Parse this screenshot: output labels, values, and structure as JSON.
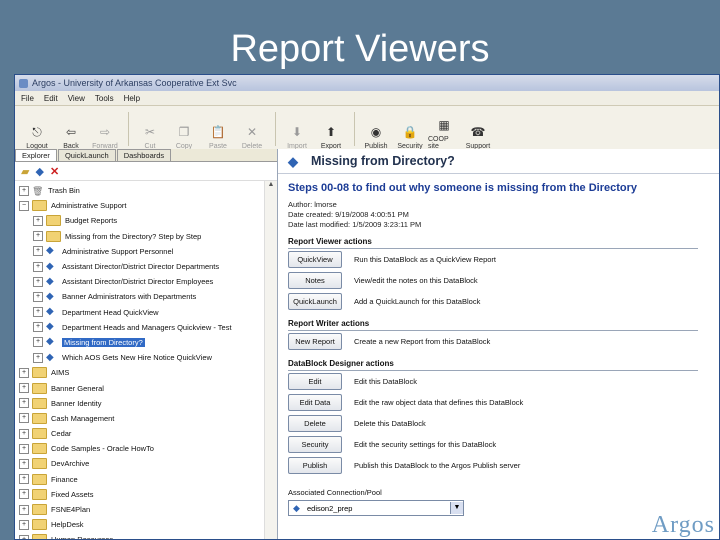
{
  "slide": {
    "title": "Report Viewers"
  },
  "window": {
    "title": "Argos - University of Arkansas Cooperative Ext Svc"
  },
  "menu": [
    "File",
    "Edit",
    "View",
    "Tools",
    "Help"
  ],
  "toolbar": [
    {
      "label": "Logout",
      "icon": "logout-icon",
      "glyph": "⎋",
      "disabled": false
    },
    {
      "label": "Back",
      "icon": "back-arrow-icon",
      "glyph": "⇦",
      "disabled": false
    },
    {
      "label": "Forward",
      "icon": "forward-arrow-icon",
      "glyph": "⇨",
      "disabled": true
    },
    {
      "label": "Cut",
      "icon": "scissors-icon",
      "glyph": "✂",
      "disabled": true
    },
    {
      "label": "Copy",
      "icon": "copy-icon",
      "glyph": "❐",
      "disabled": true
    },
    {
      "label": "Paste",
      "icon": "paste-icon",
      "glyph": "📋",
      "disabled": true
    },
    {
      "label": "Delete",
      "icon": "delete-icon",
      "glyph": "✕",
      "disabled": true
    },
    {
      "label": "Import",
      "icon": "import-icon",
      "glyph": "⬇",
      "disabled": true
    },
    {
      "label": "Export",
      "icon": "export-icon",
      "glyph": "⬆",
      "disabled": false
    },
    {
      "label": "Publish",
      "icon": "publish-globe-icon",
      "glyph": "◉",
      "disabled": false
    },
    {
      "label": "Security",
      "icon": "security-lock-icon",
      "glyph": "🔒",
      "disabled": false
    },
    {
      "label": "COOP site",
      "icon": "coop-site-icon",
      "glyph": "▦",
      "disabled": false
    },
    {
      "label": "Support",
      "icon": "support-icon",
      "glyph": "☎",
      "disabled": false
    }
  ],
  "tabs": [
    "Explorer",
    "QuickLaunch",
    "Dashboards"
  ],
  "tree": [
    {
      "label": "Trash Bin",
      "type": "trash",
      "indent": 0,
      "exp": "+"
    },
    {
      "label": "Administrative Support",
      "type": "folder",
      "indent": 0,
      "exp": "−"
    },
    {
      "label": "Budget Reports",
      "type": "folder",
      "indent": 1,
      "exp": "+"
    },
    {
      "label": "Missing from the Directory? Step by Step",
      "type": "folder",
      "indent": 1,
      "exp": "+"
    },
    {
      "label": "Administrative Support Personnel",
      "type": "db",
      "indent": 1,
      "exp": "+"
    },
    {
      "label": "Assistant Director/District Director Departments",
      "type": "db",
      "indent": 1,
      "exp": "+"
    },
    {
      "label": "Assistant Director/District Director Employees",
      "type": "db",
      "indent": 1,
      "exp": "+"
    },
    {
      "label": "Banner Administrators with Departments",
      "type": "db",
      "indent": 1,
      "exp": "+"
    },
    {
      "label": "Department Head QuickView",
      "type": "db",
      "indent": 1,
      "exp": "+"
    },
    {
      "label": "Department Heads and Managers Quickview - Test",
      "type": "db",
      "indent": 1,
      "exp": "+"
    },
    {
      "label": "Missing from Directory?",
      "type": "db",
      "indent": 1,
      "exp": "+",
      "selected": true
    },
    {
      "label": "Which AOS Gets New Hire Notice QuickView",
      "type": "db",
      "indent": 1,
      "exp": "+"
    },
    {
      "label": "AIMS",
      "type": "folder",
      "indent": 0,
      "exp": "+"
    },
    {
      "label": "Banner General",
      "type": "folder",
      "indent": 0,
      "exp": "+"
    },
    {
      "label": "Banner Identity",
      "type": "folder",
      "indent": 0,
      "exp": "+"
    },
    {
      "label": "Cash Management",
      "type": "folder",
      "indent": 0,
      "exp": "+"
    },
    {
      "label": "Cedar",
      "type": "folder",
      "indent": 0,
      "exp": "+"
    },
    {
      "label": "Code Samples - Oracle HowTo",
      "type": "folder",
      "indent": 0,
      "exp": "+"
    },
    {
      "label": "DevArchive",
      "type": "folder",
      "indent": 0,
      "exp": "+"
    },
    {
      "label": "Finance",
      "type": "folder",
      "indent": 0,
      "exp": "+"
    },
    {
      "label": "Fixed Assets",
      "type": "folder",
      "indent": 0,
      "exp": "+"
    },
    {
      "label": "FSNE4Plan",
      "type": "folder",
      "indent": 0,
      "exp": "+"
    },
    {
      "label": "HelpDesk",
      "type": "folder",
      "indent": 0,
      "exp": "+"
    },
    {
      "label": "Human Resources",
      "type": "folder",
      "indent": 0,
      "exp": "+"
    }
  ],
  "detail": {
    "header": "Missing from Directory?",
    "steps": "Steps 00-08 to find out why someone is missing from the Directory",
    "author": "Author: lmorse",
    "created": "Date created: 9/19/2008 4:00:51 PM",
    "modified": "Date last modified: 1/5/2009 3:23:11 PM",
    "sections": [
      {
        "title": "Report Viewer actions",
        "actions": [
          {
            "button": "QuickView",
            "desc": "Run this DataBlock as a QuickView Report"
          },
          {
            "button": "Notes",
            "desc": "View/edit the notes on this DataBlock"
          },
          {
            "button": "QuickLaunch",
            "desc": "Add a QuickLaunch for this DataBlock"
          }
        ]
      },
      {
        "title": "Report Writer actions",
        "actions": [
          {
            "button": "New Report",
            "desc": "Create a new Report from this DataBlock"
          }
        ]
      },
      {
        "title": "DataBlock Designer actions",
        "actions": [
          {
            "button": "Edit",
            "desc": "Edit this DataBlock"
          },
          {
            "button": "Edit Data",
            "desc": "Edit the raw object data that defines this DataBlock"
          },
          {
            "button": "Delete",
            "desc": "Delete this DataBlock"
          },
          {
            "button": "Security",
            "desc": "Edit the security settings for this DataBlock"
          },
          {
            "button": "Publish",
            "desc": "Publish this DataBlock to the Argos Publish server"
          }
        ]
      }
    ],
    "connection_label": "Associated Connection/Pool",
    "connection_value": "edison2_prep",
    "logo": "Argos"
  }
}
